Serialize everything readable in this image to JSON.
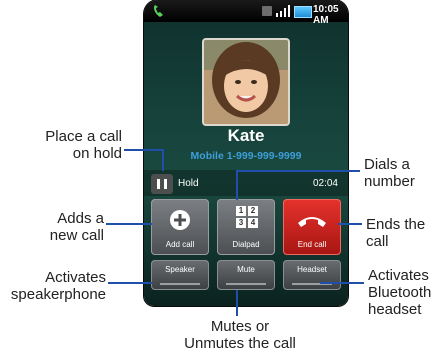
{
  "status_bar": {
    "time": "10:05 AM"
  },
  "contact": {
    "name": "Kate",
    "number": "Mobile 1-999-999-9999"
  },
  "hold": {
    "label": "Hold",
    "timer": "02:04"
  },
  "buttons": {
    "add_call": "Add call",
    "dialpad": "Dialpad",
    "dialpad_keys": [
      "1",
      "2",
      "3",
      "4"
    ],
    "end_call": "End call",
    "speaker": "Speaker",
    "mute": "Mute",
    "headset": "Headset"
  },
  "callouts": {
    "hold": [
      "Place a call",
      "on hold"
    ],
    "add_call": [
      "Adds a",
      "new call"
    ],
    "speaker": [
      "Activates",
      "speakerphone"
    ],
    "dialpad": [
      "Dials a",
      "number"
    ],
    "end_call": [
      "Ends the",
      "call"
    ],
    "headset": [
      "Activates",
      "Bluetooth",
      "headset"
    ],
    "mute": [
      "Mutes or",
      "Unmutes the call"
    ]
  },
  "colors": {
    "leader_line": "#1f4fa8",
    "end_call": "#d32822",
    "number_text": "#3e9ed8"
  },
  "icons": [
    "call-status-icon",
    "sim-icon",
    "signal-icon",
    "battery-icon",
    "pause-icon",
    "plus-icon",
    "dialpad-icon",
    "hang-up-icon"
  ]
}
